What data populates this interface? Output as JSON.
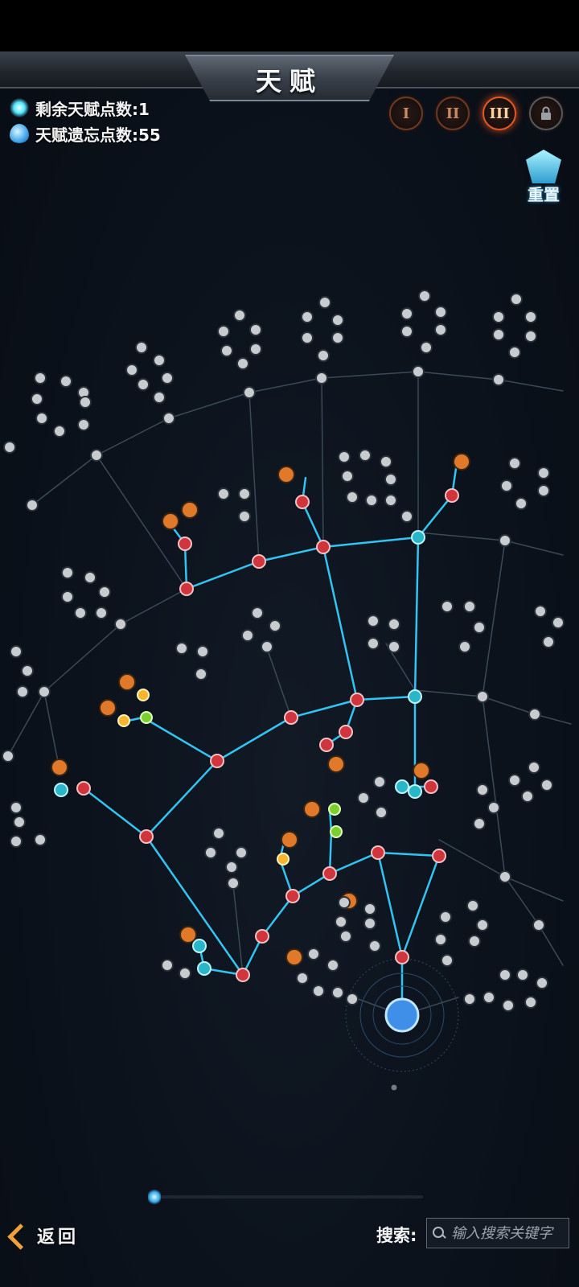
{
  "header": {
    "title": "天赋"
  },
  "points": {
    "remaining_label": "剩余天赋点数:1",
    "forget_label": "天赋遗忘点数:55"
  },
  "tiers": [
    {
      "label": "I",
      "state": "normal"
    },
    {
      "label": "II",
      "state": "normal"
    },
    {
      "label": "III",
      "state": "active"
    },
    {
      "label": "",
      "state": "locked",
      "icon": "lock-icon"
    }
  ],
  "reset": {
    "label": "重置"
  },
  "colors": {
    "path_active": "#33c4f2",
    "path_inactive": "#3a4a58",
    "node_active": "#d0343c",
    "node_cyan": "#29b6c8",
    "node_locked": "#c8ccd0",
    "node_special": "#e07a2a",
    "node_green": "#7ccf2e",
    "node_gold": "#f5b52c",
    "node_purple": "#7d3fbf"
  },
  "footer": {
    "back_label": "返回",
    "search_label": "搜索:",
    "search_placeholder": "输入搜索关键字"
  }
}
